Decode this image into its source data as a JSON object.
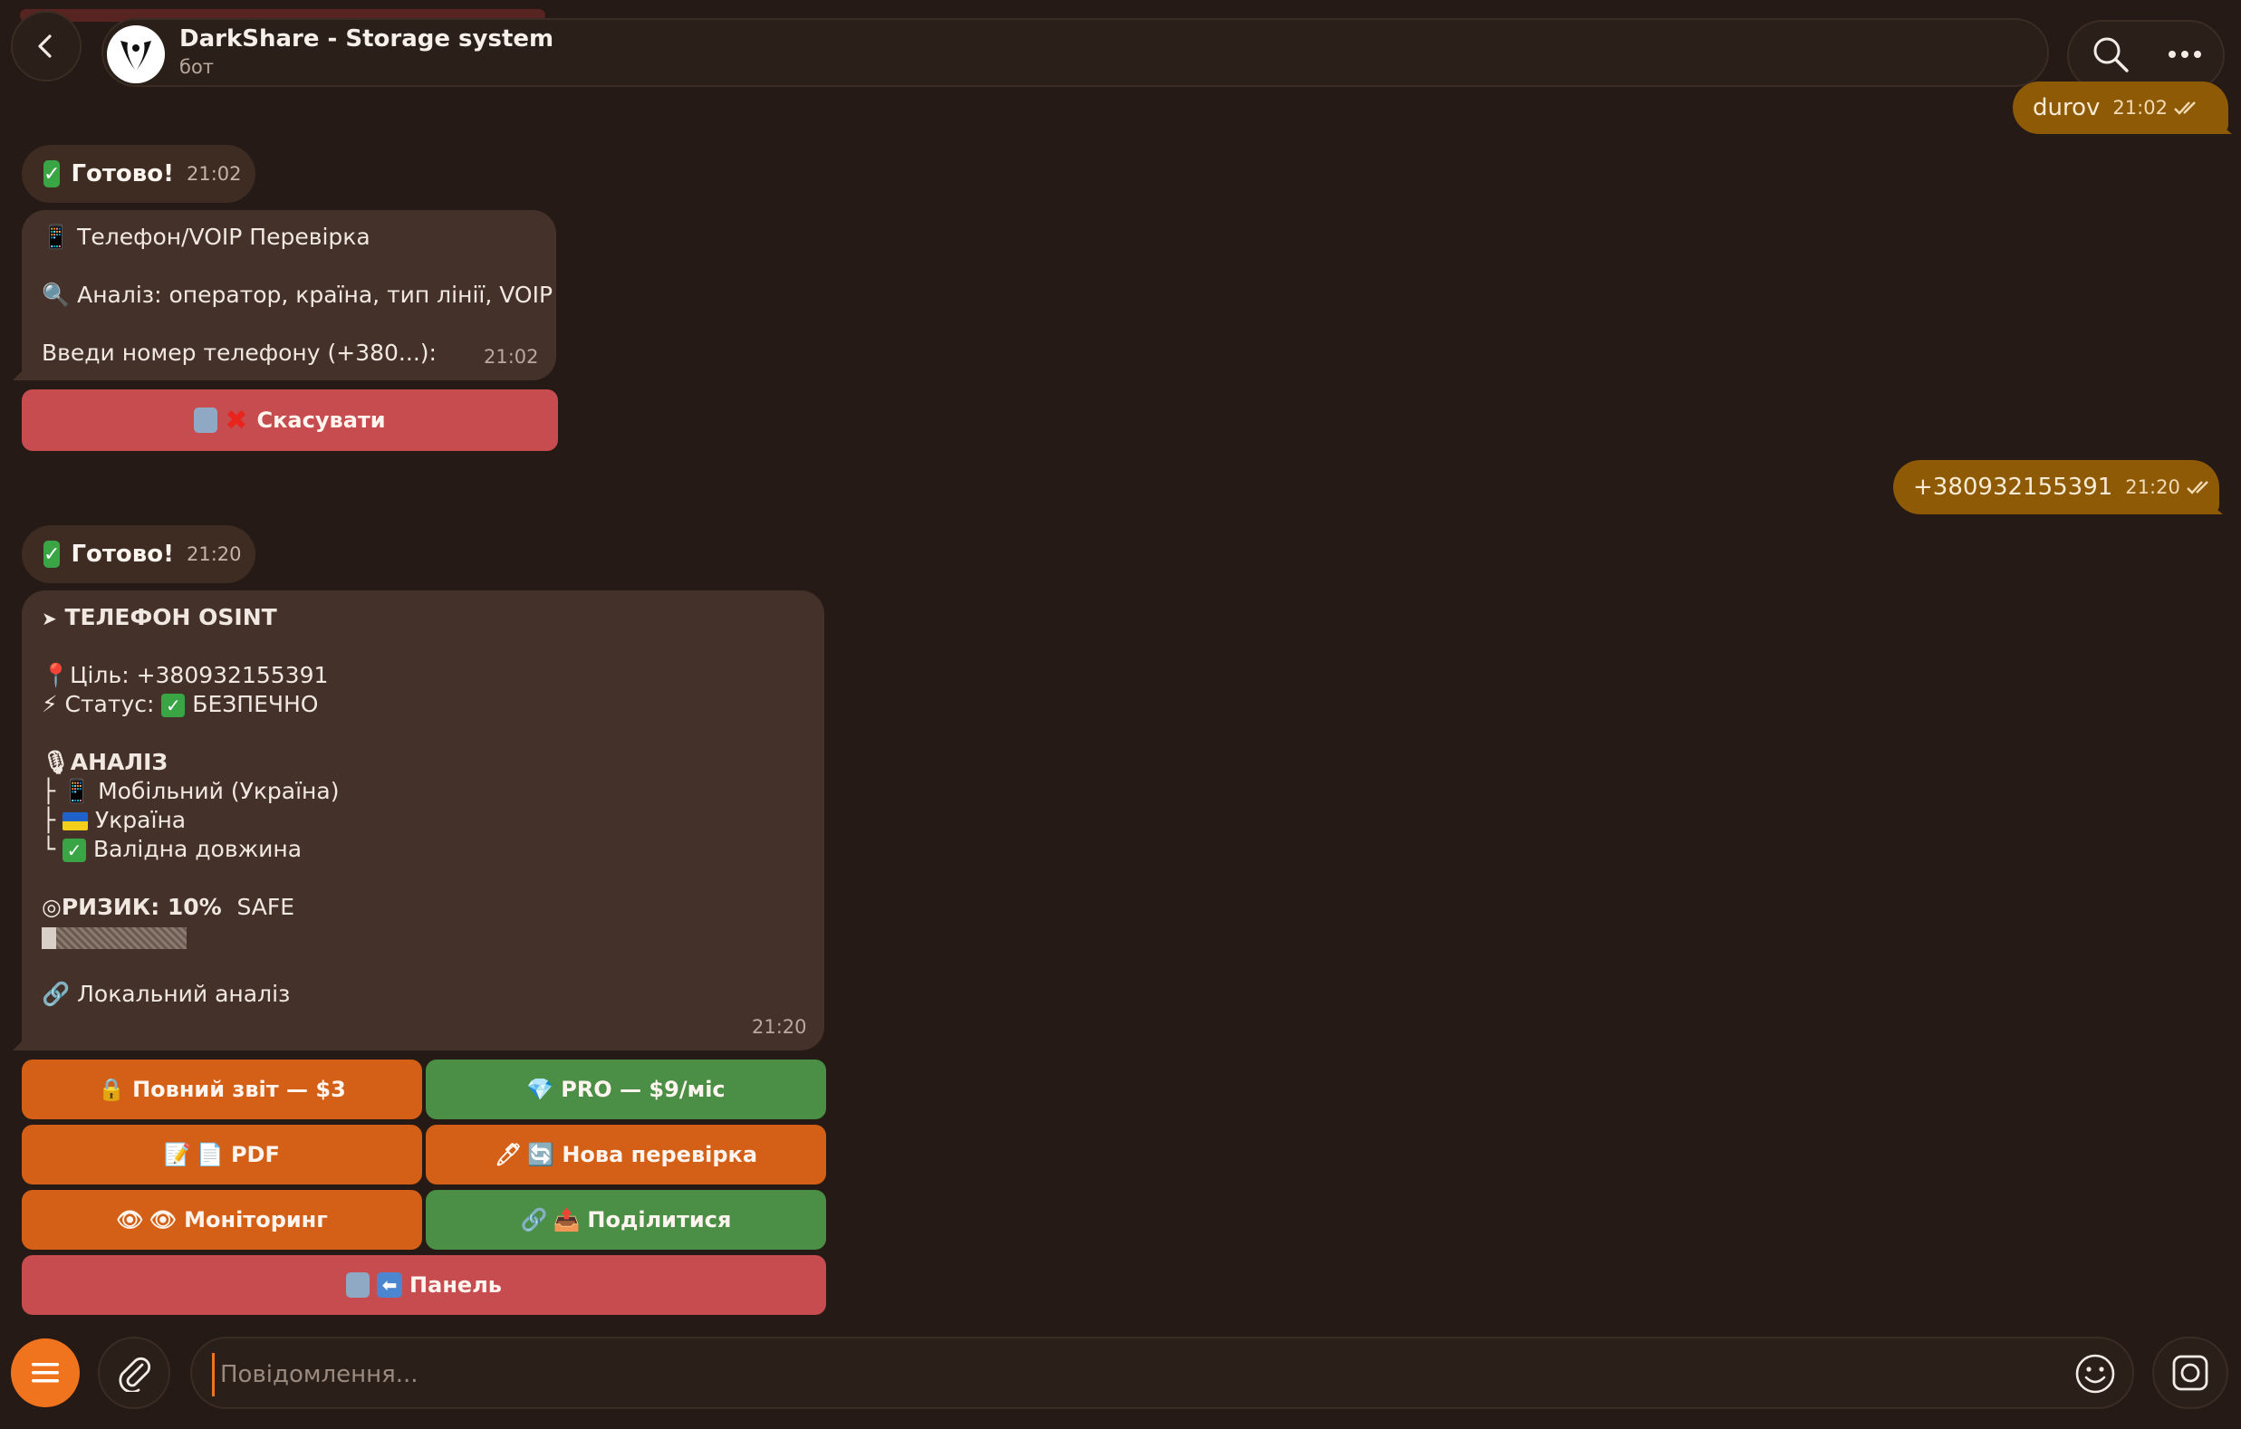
{
  "header": {
    "title": "DarkShare - Storage system",
    "subtitle": "бот"
  },
  "outgoing": [
    {
      "text": "durov",
      "time": "21:02"
    },
    {
      "text": "+380932155391",
      "time": "21:20"
    }
  ],
  "msg1": {
    "badge": "Готово!",
    "badge_time": "21:02",
    "line1": "Телефон/VOIP Перевірка",
    "line2": "Аналіз: оператор, країна, тип лінії, VOIP",
    "line3": "Введи номер телефону (+380...):",
    "time": "21:02",
    "cancel_button": "Скасувати"
  },
  "msg2": {
    "badge": "Готово!",
    "badge_time": "21:20",
    "heading": "ТЕЛЕФОН OSINT",
    "target": "Ціль: +380932155391",
    "status_label": "Статус:",
    "status_value": "БЕЗПЕЧНО",
    "analysis_heading": "АНАЛІЗ",
    "tree": [
      {
        "prefix": "├",
        "text": "Мобільний (Україна)"
      },
      {
        "prefix": "├",
        "text": "Україна"
      },
      {
        "prefix": "└",
        "text": "Валідна довжина"
      }
    ],
    "risk_label": "РИЗИК: 10%",
    "risk_state": "SAFE",
    "risk_level": 0.1,
    "local": "Локальний аналіз",
    "time": "21:20"
  },
  "keyboard": {
    "full_report": "Повний звіт — $3",
    "pro": "PRO — $9/міс",
    "pdf": "PDF",
    "new_check": "Нова перевірка",
    "monitoring": "Моніторинг",
    "share": "Поділитися",
    "panel": "Панель"
  },
  "composer": {
    "placeholder": "Повідомлення..."
  },
  "colors": {
    "background": "#251a15",
    "outgoing_bubble": "#8e5a06",
    "incoming_bubble": "#44322a",
    "red_button": "#c64c50",
    "orange_button": "#d45f17",
    "green_button": "#4a8f45",
    "accent": "#f0731e"
  }
}
